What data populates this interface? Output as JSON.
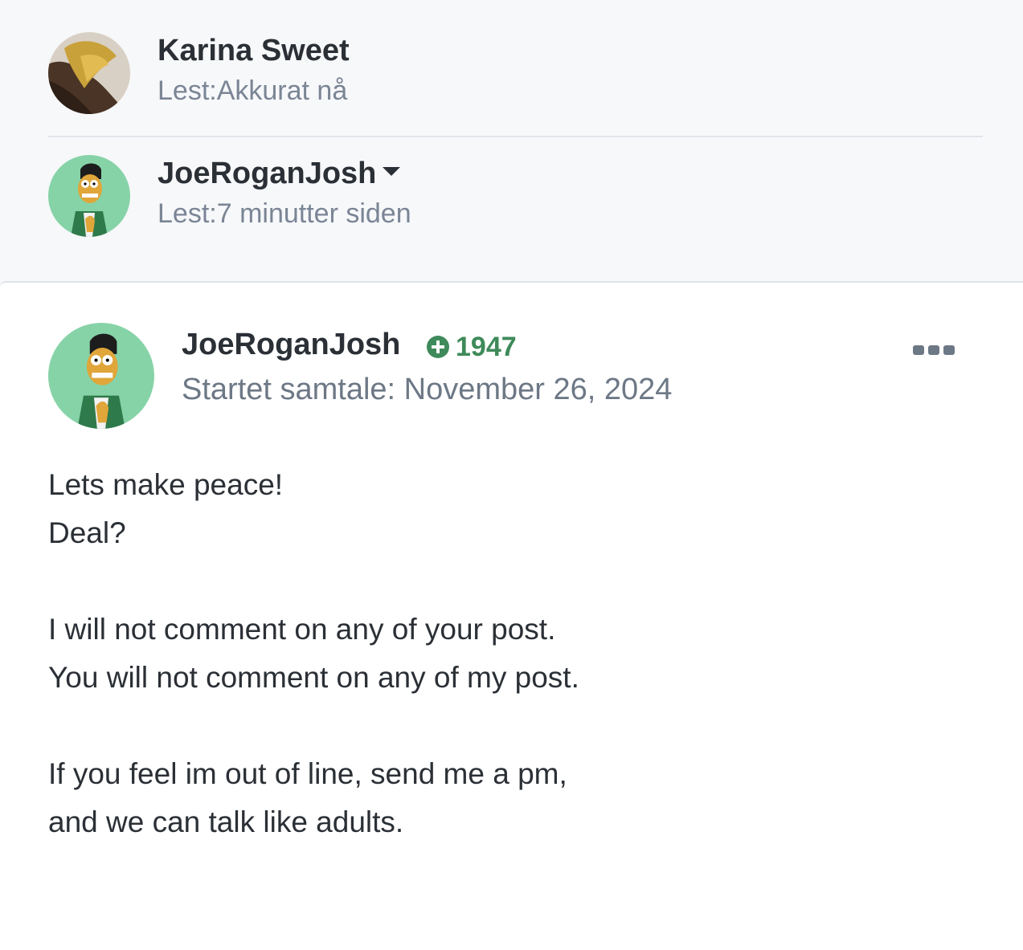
{
  "participants": [
    {
      "name": "Karina Sweet",
      "read": "Lest:Akkurat nå",
      "avatar": "photo-avatar"
    },
    {
      "name": "JoeRoganJosh",
      "read": "Lest:7 minutter siden",
      "avatar": "cartoon-avatar",
      "has_dropdown": true
    }
  ],
  "message": {
    "author": "JoeRoganJosh",
    "reputation": "1947",
    "started": "Startet samtale: November 26, 2024",
    "lines": [
      "Lets make peace!",
      "Deal?",
      "I will not comment on any of your post.",
      "You will not comment on any of my post.",
      "If you feel im out of line, send me a pm,",
      "and we can talk like adults."
    ]
  },
  "colors": {
    "reputation": "#3e8a5a",
    "avatar_bg": "#86d3a8",
    "background": "#f7f8fa"
  }
}
